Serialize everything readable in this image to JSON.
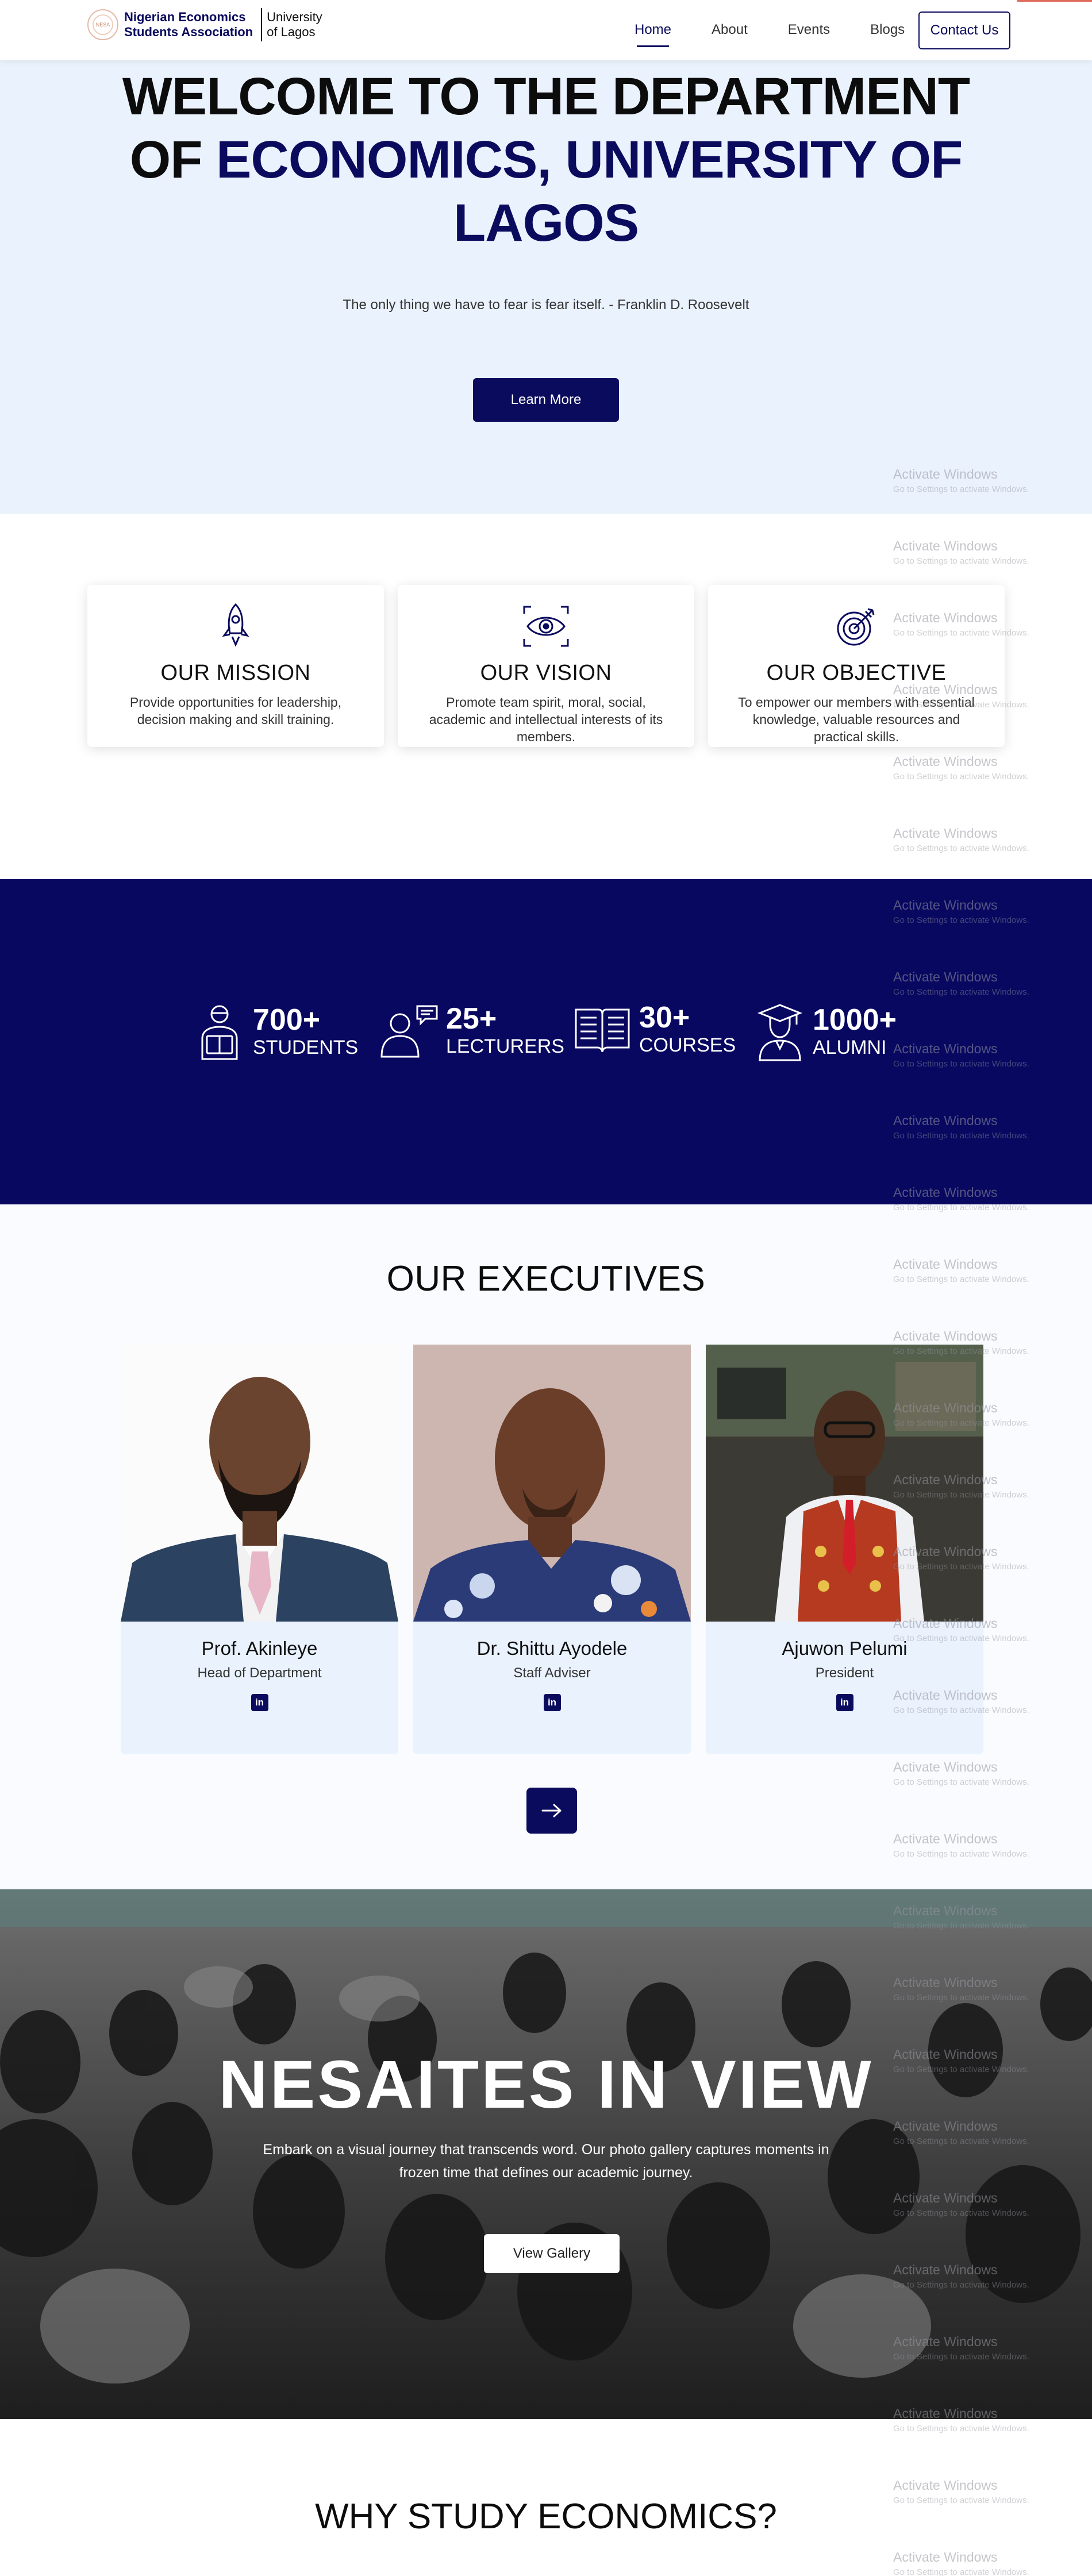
{
  "nav": {
    "org_name": "Nigerian Economics\nStudents Association",
    "university": "University\nof Lagos",
    "seal_text": "NESA",
    "links": [
      "Home",
      "About",
      "Events",
      "Blogs"
    ],
    "contact_label": "Contact Us"
  },
  "hero": {
    "title_plain": "WELCOME TO THE DEPARTMENT OF ",
    "title_highlight": "ECONOMICS, UNIVERSITY OF LAGOS",
    "quote": "The only thing we have to fear is fear itself. - Franklin D. Roosevelt",
    "button": "Learn More"
  },
  "cards": [
    {
      "icon": "rocket-icon",
      "title": "OUR MISSION",
      "text": "Provide opportunities for leadership, decision making and skill training."
    },
    {
      "icon": "eye-icon",
      "title": "OUR VISION",
      "text": "Promote team spirit, moral, social, academic and intellectual interests of its members."
    },
    {
      "icon": "target-icon",
      "title": "OUR OBJECTIVE",
      "text": "To empower our members with essential knowledge, valuable resources and practical skills."
    }
  ],
  "stats": [
    {
      "icon": "student-icon",
      "number": "700+",
      "label": "STUDENTS"
    },
    {
      "icon": "lecturer-icon",
      "number": "25+",
      "label": "LECTURERS"
    },
    {
      "icon": "book-icon",
      "number": "30+",
      "label": "COURSES"
    },
    {
      "icon": "graduate-icon",
      "number": "1000+",
      "label": "ALUMNI"
    }
  ],
  "executives": {
    "title": "OUR EXECUTIVES",
    "members": [
      {
        "name": "Prof. Akinleye",
        "role": "Head of Department",
        "social": "linkedin-icon"
      },
      {
        "name": "Dr. Shittu Ayodele",
        "role": "Staff Adviser",
        "social": "linkedin-icon"
      },
      {
        "name": "Ajuwon Pelumi",
        "role": "President",
        "social": "linkedin-icon"
      }
    ],
    "next_icon": "arrow-right-icon"
  },
  "gallery": {
    "title": "NESAITES IN VIEW",
    "text": "Embark on a visual journey that transcends word. Our photo gallery captures moments in frozen time that defines our academic journey.",
    "button": "View Gallery"
  },
  "why": {
    "title": "WHY STUDY ECONOMICS?"
  },
  "watermark": {
    "line1": "Activate Windows",
    "line2": "Go to Settings to activate Windows."
  },
  "colors": {
    "navy": "#0b0b5e",
    "hero_bg": "#eaf2fd",
    "stats_bg": "#080860",
    "card_bg": "#e9f2fd"
  }
}
